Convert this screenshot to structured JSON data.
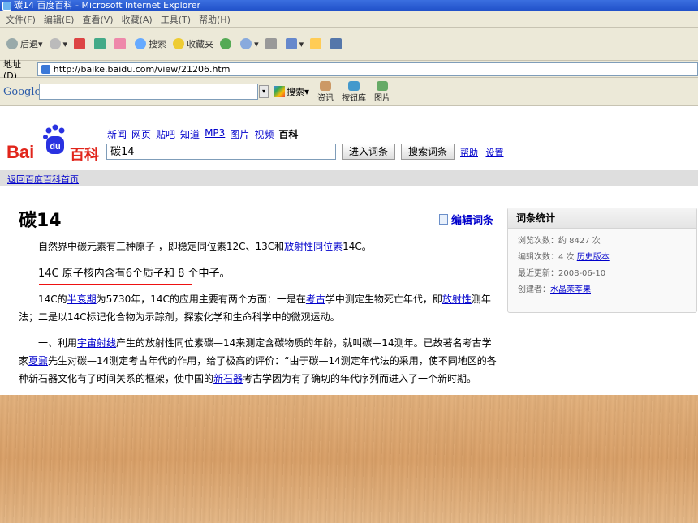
{
  "window": {
    "title": "碳14 百度百科 - Microsoft Internet Explorer"
  },
  "menu": [
    "文件(F)",
    "编辑(E)",
    "查看(V)",
    "收藏(A)",
    "工具(T)",
    "帮助(H)"
  ],
  "toolbar": {
    "back": "后退",
    "search": "搜索",
    "favorites": "收藏夹"
  },
  "address": {
    "label": "地址(D)",
    "url": "http://baike.baidu.com/view/21206.htm"
  },
  "google_bar": {
    "logo": "Google",
    "search": "搜索",
    "tools": [
      "资讯",
      "按钮库",
      "图片"
    ]
  },
  "baidu": {
    "logo_bai": "Bai",
    "logo_du": "du",
    "logo_baike": "百科",
    "nav": [
      "新闻",
      "网页",
      "贴吧",
      "知道",
      "MP3",
      "图片",
      "视频"
    ],
    "nav_current": "百科",
    "search_value": "碳14",
    "enter_button": "进入词条",
    "search_button": "搜索词条",
    "help": "帮助",
    "settings": "设置",
    "back_home": "返回百度百科首页"
  },
  "article": {
    "title": "碳14",
    "edit": "编辑词条",
    "p1_a": "自然界中碳元素有三种原子 ，即稳定同位素12C、13C和",
    "p1_link": "放射性同位素",
    "p1_b": "14C。",
    "p2": "14C 原子核内含有6个质子和 8 个中子。",
    "p3_a": "14C的",
    "p3_link1": "半衰期",
    "p3_b": "为5730年，14C的应用主要有两个方面：一是在",
    "p3_link2": "考古",
    "p3_c": "学中测定生物死亡年代，即",
    "p3_link3": "放射性",
    "p3_d": "测年法；二是以14C标记化合物为示踪剂，探索化学和生命科学中的微观运动。",
    "p4_a": "一、利用",
    "p4_link1": "宇宙射线",
    "p4_b": "产生的放射性同位素碳—14来测定含碳物质的年龄，就叫碳—14测年。已故著名考古学家",
    "p4_link2": "夏鼐",
    "p4_c": "先生对碳—14测定考古年代的作用，给了极高的评价：“由于碳—14测定年代法的采用，使不同地区的各种新石器文化有了时间关系的框架，使中国的",
    "p4_link3": "新石器",
    "p4_d": "考古学因为有了确切的年代序列而进入了一个新时期。"
  },
  "stats": {
    "heading": "词条统计",
    "views": "浏览次数：约 8427 次",
    "edits": "编辑次数：4 次",
    "history": "历史版本",
    "updated": "最近更新：2008-06-10",
    "creator_label": "创建者：",
    "creator": "水晶茉莘果"
  }
}
